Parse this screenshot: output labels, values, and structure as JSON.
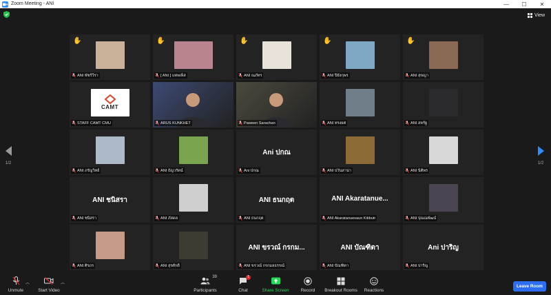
{
  "window": {
    "title": "Zoom Meeting - ANI",
    "controls": [
      "—",
      "☐",
      "✕"
    ]
  },
  "view_label": "View",
  "pager": {
    "page": "1/2"
  },
  "tiles": [
    {
      "label": "ANI พัชร์วีรา",
      "raised": true,
      "thumb": "#c9b19a",
      "kind": "avatar"
    },
    {
      "label": "[ ANI ] แทพเพ็ส",
      "raised": true,
      "thumb": "#b9848e",
      "kind": "avatar",
      "wide": true
    },
    {
      "label": "ANI ณภัทร",
      "raised": true,
      "thumb": "#e8e2d8",
      "kind": "avatar"
    },
    {
      "label": "ANI ปิยังกุพร",
      "raised": true,
      "thumb": "#7fa8c4",
      "kind": "avatar"
    },
    {
      "label": "ANI สุขญา",
      "raised": true,
      "thumb": "#8a6a55",
      "kind": "avatar"
    },
    {
      "label": "STAFF CAMT CMU",
      "raised": false,
      "kind": "logo",
      "logo_text": "CAMT"
    },
    {
      "label": "ARUS KUNKHET",
      "raised": false,
      "kind": "video",
      "active": true,
      "video_bg": "#3d4a73"
    },
    {
      "label": "Paween Sarachan",
      "raised": false,
      "kind": "video",
      "video_bg": "#4c4a3e"
    },
    {
      "label": "ANI ทรงยศ",
      "raised": false,
      "thumb": "#6f7e88",
      "kind": "avatar"
    },
    {
      "label": "ANI สหรัฐ",
      "raised": false,
      "thumb": "#2b2b2e",
      "kind": "avatar"
    },
    {
      "label": "ANI ภรัญวิทย์",
      "raised": false,
      "thumb": "#aeb9c7",
      "kind": "avatar"
    },
    {
      "label": "ANI ธัญวรัตน์",
      "raised": false,
      "thumb": "#7aa54e",
      "kind": "avatar"
    },
    {
      "label": "Ani ปกณ",
      "raised": false,
      "kind": "name",
      "big_name": "Ani ปกณ"
    },
    {
      "label": "ANI ปวันสาน่า",
      "raised": false,
      "thumb": "#8c6b36",
      "kind": "avatar"
    },
    {
      "label": "ANI นิติพร",
      "raised": false,
      "thumb": "#d8d8d8",
      "kind": "avatar"
    },
    {
      "label": "ANI ชนิสรา",
      "raised": false,
      "kind": "name",
      "big_name": "ANI ชนิสรา"
    },
    {
      "label": "ANI ภัสดล",
      "raised": false,
      "thumb": "#cfcfcf",
      "kind": "avatar"
    },
    {
      "label": "ANI ธนกฤต",
      "raised": false,
      "kind": "name",
      "big_name": "ANI ธนกฤต"
    },
    {
      "label": "ANI Akaratanuesaun Kitibutr",
      "raised": false,
      "kind": "name",
      "big_name": "ANI Akaratanue..."
    },
    {
      "label": "ANI ปุณณพัฒน์",
      "raised": false,
      "thumb": "#4a4550",
      "kind": "avatar"
    },
    {
      "label": "ANI ศิรภร",
      "raised": false,
      "thumb": "#c79a88",
      "kind": "avatar"
    },
    {
      "label": "ANI สุรศักดิ์",
      "raised": false,
      "thumb": "#3e3b33",
      "kind": "avatar"
    },
    {
      "label": "ANI ขรวณ์ กรกมลธรรณ์",
      "raised": false,
      "kind": "name",
      "big_name": "ANI ขรวณ์ กรกม..."
    },
    {
      "label": "ANI บัณฑิตา",
      "raised": false,
      "kind": "name",
      "big_name": "ANI บัณฑิตา"
    },
    {
      "label": "ANI ปาริญ",
      "raised": false,
      "kind": "name",
      "big_name": "Ani ปาริญ"
    }
  ],
  "toolbar": {
    "unmute": "Unmute",
    "start_video": "Start Video",
    "participants": "Participants",
    "participants_count": "39",
    "chat": "Chat",
    "chat_badge": "1",
    "share_screen": "Share Screen",
    "record": "Record",
    "breakout_rooms": "Breakout Rooms",
    "reactions": "Reactions",
    "leave": "Leave Room"
  },
  "colors": {
    "accent": "#2d8cff",
    "leave": "#2d6ef0",
    "share": "#23d959",
    "active_speaker": "#c8d94a",
    "muted_mic": "#e02828"
  }
}
